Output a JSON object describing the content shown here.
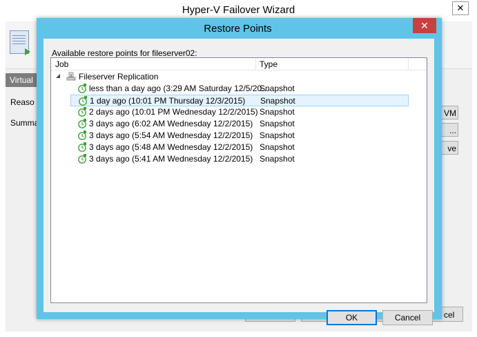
{
  "wizard": {
    "title": "Hyper-V Failover Wizard",
    "close_glyph": "✕",
    "steps": [
      "Virtual",
      "Reaso",
      "Summa"
    ],
    "right_buttons": [
      "VM",
      "...",
      "ve"
    ],
    "bottom_button_partial": "cel"
  },
  "dialog": {
    "title": "Restore Points",
    "close_glyph": "✕",
    "label": "Available restore points for fileserver02:",
    "columns": {
      "job": "Job",
      "type": "Type"
    },
    "group": {
      "name": "Fileserver Replication",
      "icon": "replication-job-icon",
      "expander_icon": "collapse-triangle-icon"
    },
    "rows": [
      {
        "name": "less than a day ago (3:29 AM Saturday 12/5/20...",
        "type": "Snapshot",
        "selected": false
      },
      {
        "name": "1 day ago (10:01 PM Thursday 12/3/2015)",
        "type": "Snapshot",
        "selected": true
      },
      {
        "name": "2 days ago (10:01 PM Wednesday 12/2/2015)",
        "type": "Snapshot",
        "selected": false
      },
      {
        "name": "3 days ago (6:02 AM Wednesday 12/2/2015)",
        "type": "Snapshot",
        "selected": false
      },
      {
        "name": "3 days ago (5:54 AM Wednesday 12/2/2015)",
        "type": "Snapshot",
        "selected": false
      },
      {
        "name": "3 days ago (5:48 AM Wednesday 12/2/2015)",
        "type": "Snapshot",
        "selected": false
      },
      {
        "name": "3 days ago (5:41 AM Wednesday 12/2/2015)",
        "type": "Snapshot",
        "selected": false
      }
    ],
    "ok_label": "OK",
    "cancel_label": "Cancel"
  },
  "colors": {
    "dialog_frame": "#5fc4e8",
    "close_red": "#c74141",
    "selection": "#e5f3ff",
    "icon_green": "#3fa03a"
  }
}
